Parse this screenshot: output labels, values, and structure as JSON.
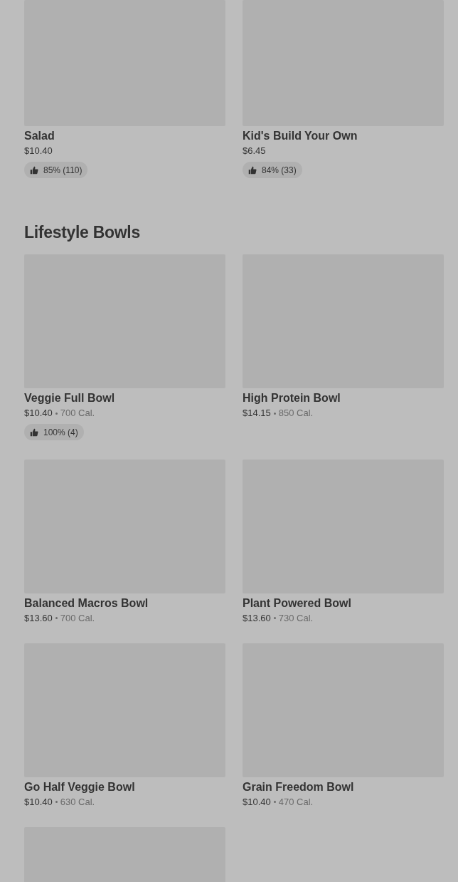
{
  "top_items": [
    {
      "kind": "full",
      "name": "Salad",
      "price": "$10.40",
      "rating": "85% (110)"
    },
    {
      "kind": "full",
      "name": "Kid's Build Your Own",
      "price": "$6.45",
      "rating": "84% (33)"
    }
  ],
  "sections": [
    {
      "title": "Lifestyle Bowls",
      "items": [
        {
          "kind": "full",
          "name": "Veggie Full Bowl",
          "price": "$10.40",
          "calories": "700 Cal.",
          "rating": "100% (4)"
        },
        {
          "kind": "full",
          "name": "High Protein Bowl",
          "price": "$14.15",
          "calories": "850 Cal."
        },
        {
          "kind": "full",
          "name": "Balanced Macros Bowl",
          "price": "$13.60",
          "calories": "700 Cal."
        },
        {
          "kind": "full",
          "name": "Plant Powered Bowl",
          "price": "$13.60",
          "calories": "730 Cal."
        },
        {
          "kind": "full",
          "name": "Go Half Veggie Bowl",
          "price": "$10.40",
          "calories": "630 Cal."
        },
        {
          "kind": "full",
          "name": "Grain Freedom Bowl",
          "price": "$10.40",
          "calories": "470 Cal."
        },
        {
          "kind": "image-only"
        }
      ]
    }
  ]
}
